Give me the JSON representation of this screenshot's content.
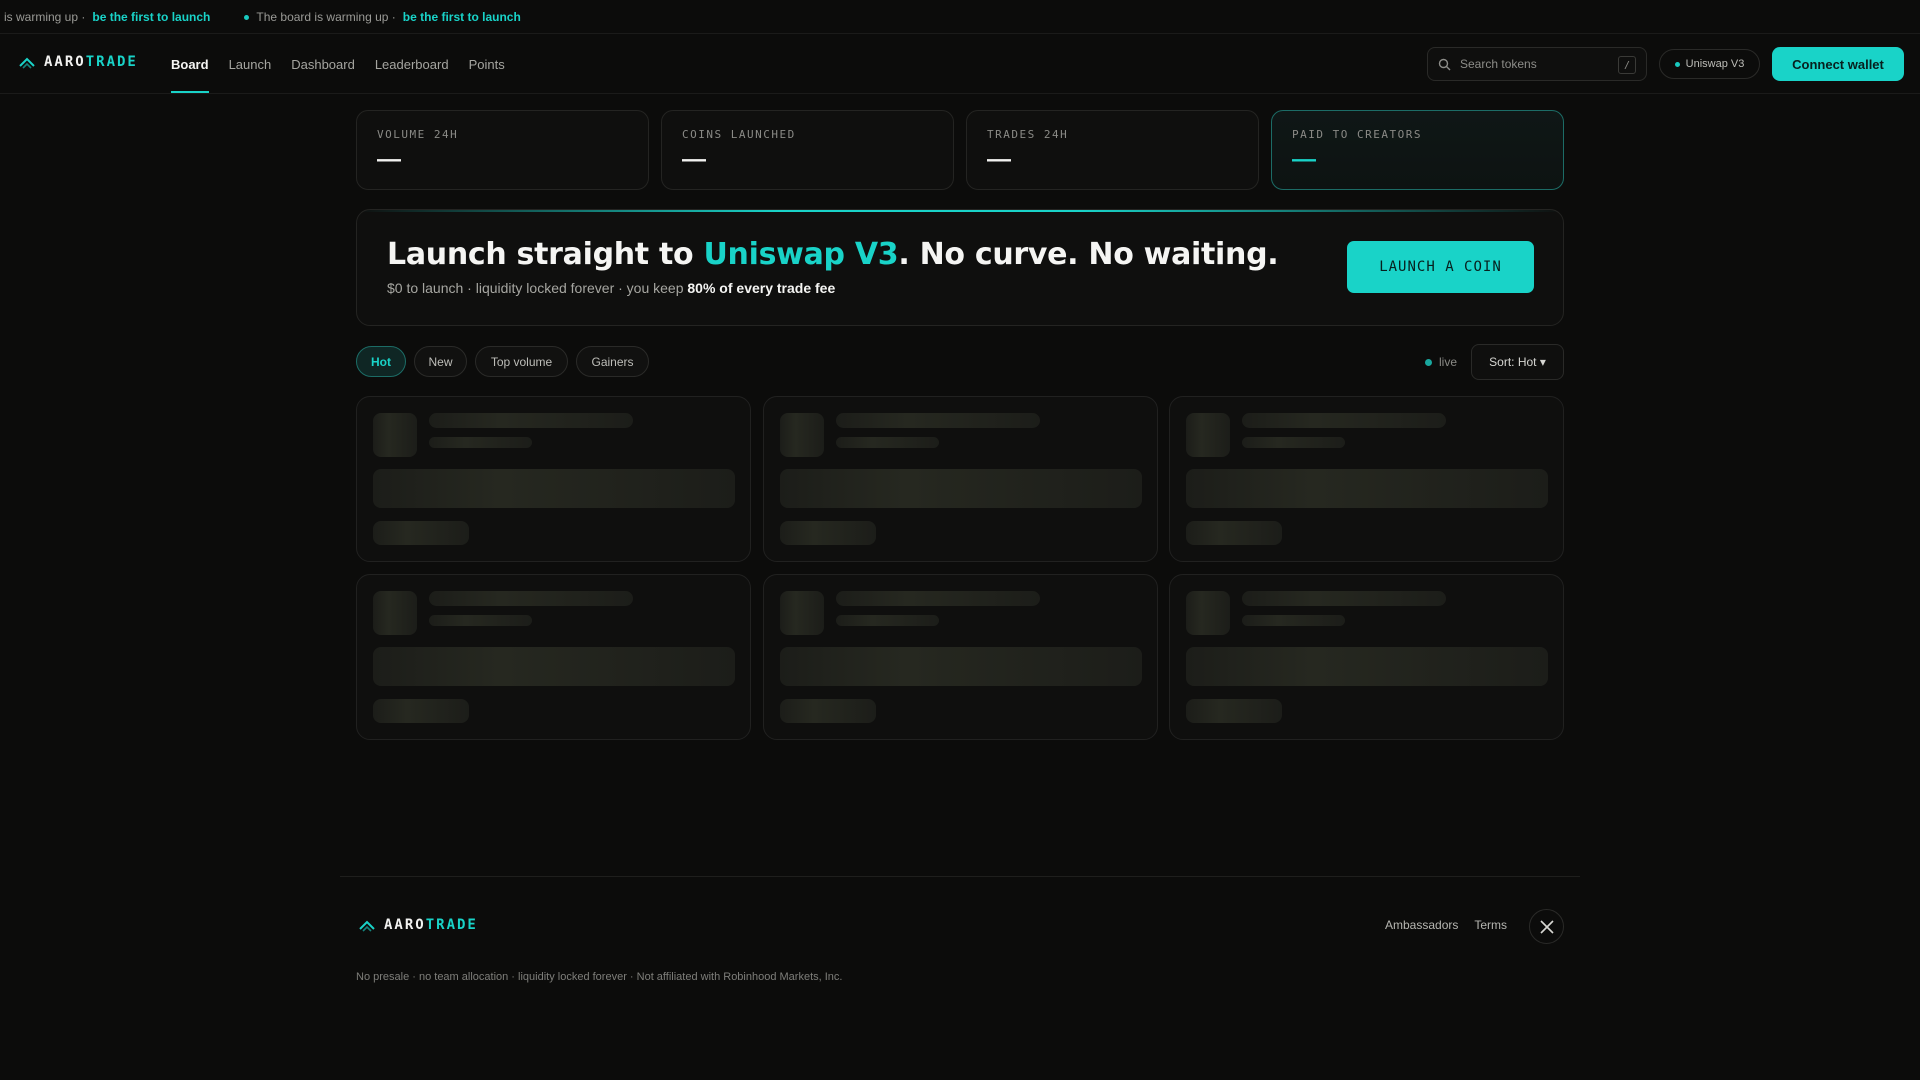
{
  "ticker": {
    "items": [
      {
        "text": "rd is warming up ·",
        "accent": "be the first to launch"
      },
      {
        "text": "The board is warming up ·",
        "accent": "be the first to launch"
      }
    ]
  },
  "brand": {
    "part_a": "AARO",
    "part_b": "TRADE"
  },
  "nav": {
    "links": [
      {
        "label": "Board",
        "active": true
      },
      {
        "label": "Launch"
      },
      {
        "label": "Dashboard"
      },
      {
        "label": "Leaderboard"
      },
      {
        "label": "Points"
      }
    ]
  },
  "search": {
    "placeholder": "Search tokens",
    "shortcut": "/"
  },
  "network": {
    "label": "Uniswap V3"
  },
  "header": {
    "connect_label": "Connect wallet"
  },
  "stats": [
    {
      "label": "VOLUME 24H",
      "value": "—"
    },
    {
      "label": "COINS LAUNCHED",
      "value": "—"
    },
    {
      "label": "TRADES 24H",
      "value": "—"
    },
    {
      "label": "PAID TO CREATORS",
      "value": "—"
    }
  ],
  "hero": {
    "title_pre": "Launch straight to ",
    "title_accent": "Uniswap V3",
    "title_post": ". No curve. No waiting.",
    "sub_pre": "$0 to launch · liquidity locked forever · you keep ",
    "sub_strong": "80% of every trade fee",
    "cta": "LAUNCH A COIN"
  },
  "filters": [
    {
      "label": "Hot",
      "active": true
    },
    {
      "label": "New"
    },
    {
      "label": "Top volume"
    },
    {
      "label": "Gainers"
    }
  ],
  "live_label": "live",
  "sort_label": "Sort: Hot ▾",
  "footer": {
    "links": [
      "Ambassadors",
      "Terms"
    ],
    "note": "No presale · no team allocation · liquidity locked forever · Not affiliated with Robinhood Markets, Inc."
  },
  "colors": {
    "accent": "#19d3c8",
    "background": "#0c0c0b"
  },
  "icons": [
    "brand-chevron-icon",
    "search-icon",
    "x-logo-icon"
  ]
}
